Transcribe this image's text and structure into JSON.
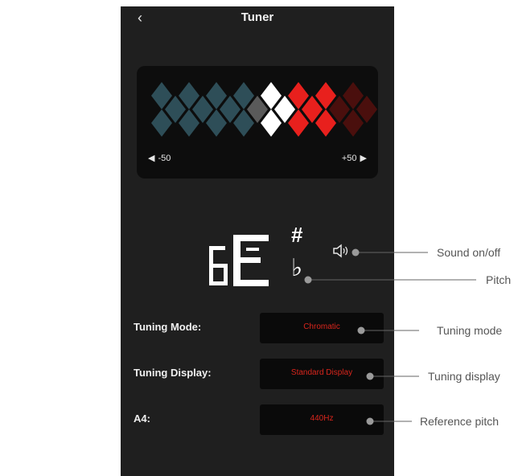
{
  "header": {
    "title": "Tuner",
    "back_icon": "chevron-left-icon"
  },
  "meter": {
    "left_label": "-50",
    "right_label": "+50",
    "colors": {
      "flat": "#2e4e58",
      "center": "#5a5a5a",
      "in_tune": "#ffffff",
      "active": "#e8201d",
      "sharp": "#4a0f0d"
    }
  },
  "note": {
    "display": "6E",
    "sharp_symbol": "#",
    "flat_symbol": "♭"
  },
  "sound": {
    "icon": "speaker-icon"
  },
  "settings": [
    {
      "label": "Tuning Mode:",
      "value": "Chromatic"
    },
    {
      "label": "Tuning Display:",
      "value": "Standard Display"
    },
    {
      "label": "A4:",
      "value": "440Hz"
    }
  ],
  "callouts": {
    "sound": "Sound on/off",
    "pitch": "Pitch",
    "tuning_mode": "Tuning mode",
    "tuning_display": "Tuning display",
    "reference_pitch": "Reference pitch"
  }
}
